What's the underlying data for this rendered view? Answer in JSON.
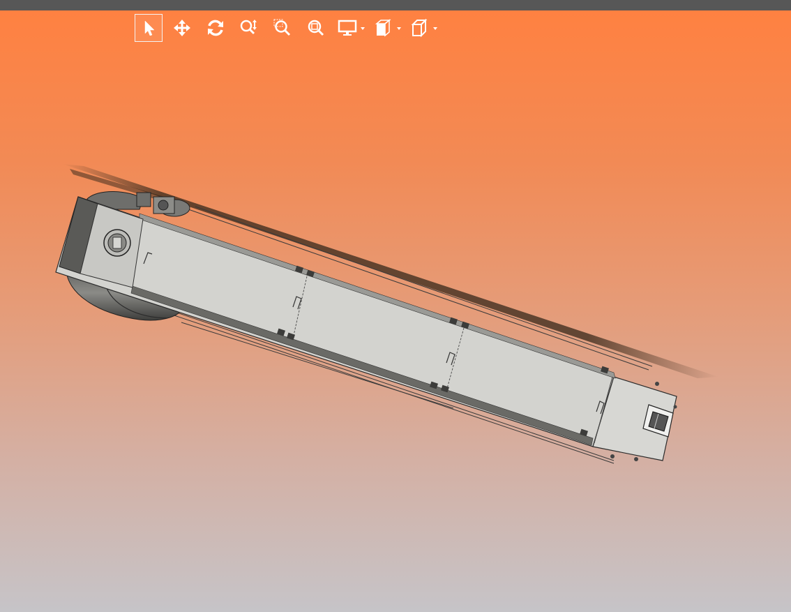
{
  "window": {
    "title_bar_color": "#575757"
  },
  "viewport": {
    "background_top": "#ff8141",
    "background_bottom": "#c6c4c8"
  },
  "toolbar": {
    "tools": [
      {
        "name": "select",
        "icon": "arrow-cursor-icon",
        "active": true
      },
      {
        "name": "pan",
        "icon": "four-way-arrows-icon",
        "active": false
      },
      {
        "name": "rotate",
        "icon": "rotate-icon",
        "active": false
      },
      {
        "name": "zoom-in-out",
        "icon": "zoom-updown-icon",
        "active": false
      },
      {
        "name": "zoom-to-area",
        "icon": "zoom-area-icon",
        "active": false
      },
      {
        "name": "zoom-to-fit",
        "icon": "zoom-fit-icon",
        "active": false
      },
      {
        "name": "display-style",
        "icon": "monitor-icon",
        "has_dropdown": true
      },
      {
        "name": "section-view",
        "icon": "section-icon",
        "has_dropdown": true
      },
      {
        "name": "view-orientation",
        "icon": "cube-icon",
        "has_dropdown": true
      }
    ]
  },
  "model": {
    "description_color": "#d0d0cc",
    "accent": "#444444"
  }
}
